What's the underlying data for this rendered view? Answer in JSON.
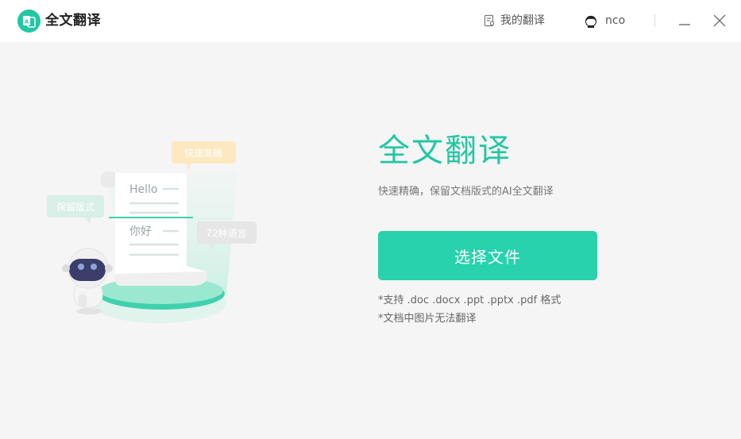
{
  "app": {
    "title": "全文翻译"
  },
  "header": {
    "my_translations": "我的翻译",
    "username": "nco"
  },
  "illustration": {
    "bubble_fast": "快速准确",
    "bubble_layout": "保留版式",
    "bubble_languages": "72种语言",
    "doc_hello": "Hello",
    "doc_nihao": "你好"
  },
  "main": {
    "title": "全文翻译",
    "subtitle": "快速精确，保留文档版式的AI全文翻译",
    "select_button": "选择文件",
    "note_formats": "*支持 .doc .docx .ppt .pptx .pdf 格式",
    "note_images": "*文档中图片无法翻译"
  },
  "colors": {
    "accent": "#22c7a3",
    "button": "#27d2ad",
    "bubble_yellow": "#fde8bf",
    "bubble_green": "#d7efe6",
    "bubble_gray": "#e6e6e6"
  }
}
